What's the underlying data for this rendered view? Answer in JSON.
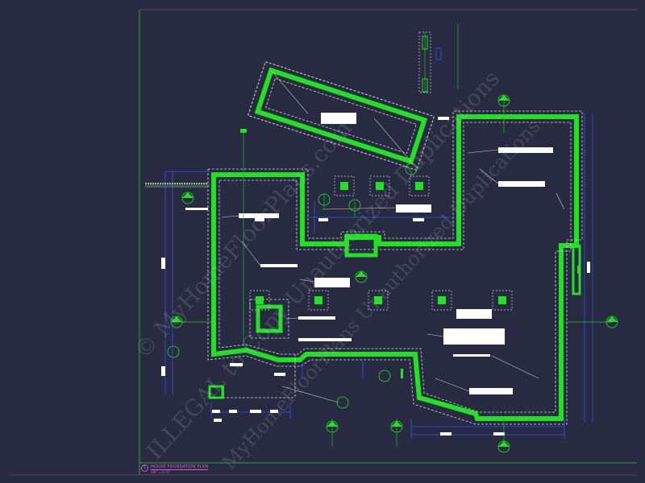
{
  "drawing": {
    "sheet_title": "HOUSE FOUNDATION PLAN",
    "scale": "1/8\" = 1'-0\"",
    "detail_number": "1"
  },
  "watermark": {
    "line1": "© MyHomeFloorPlans.com",
    "line2": "ILLEGAL to Copy Unauthorized Duplications",
    "line3": "MyHomeFloorPlans Unauthorized Duplications"
  },
  "colors": {
    "background": "#272a40",
    "foundation_wall": "#22e022",
    "footing_dash": "#d8d8d8",
    "dimension": "#3050ff",
    "border": "#2ea82e",
    "annotation": "#ffffff",
    "title": "#d060d0"
  },
  "icons": {
    "section_marker": "circle-with-arrow",
    "grid_bubble": "circle-marker"
  }
}
